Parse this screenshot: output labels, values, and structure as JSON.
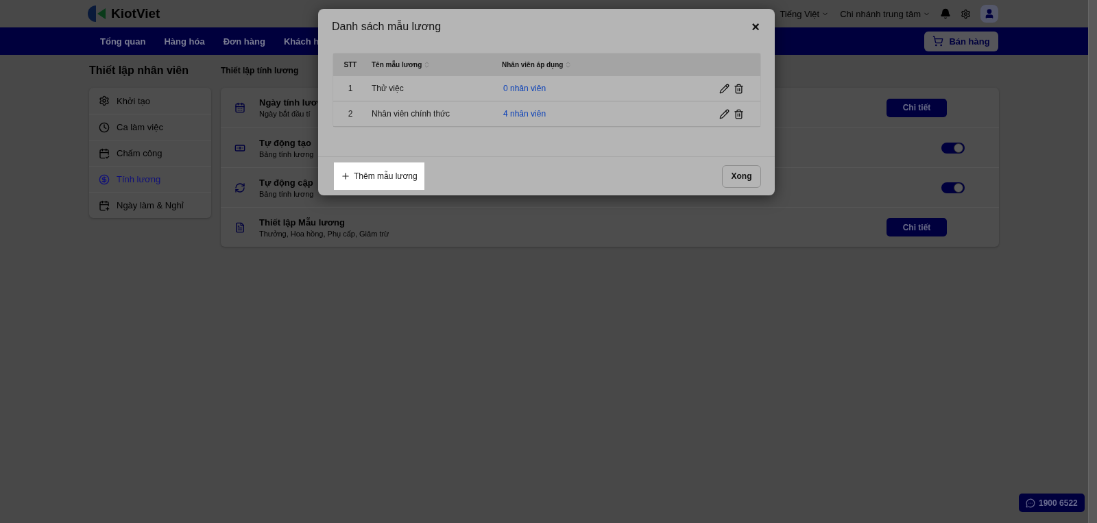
{
  "header": {
    "logo": "KiotViet",
    "language": "Tiếng Việt",
    "branch": "Chi nhánh trung tâm"
  },
  "nav": {
    "items": [
      {
        "label": "Tổng quan"
      },
      {
        "label": "Hàng hóa"
      },
      {
        "label": "Đơn hàng"
      },
      {
        "label": "Khách h"
      }
    ],
    "sell_button": "Bán hàng"
  },
  "sidebar": {
    "title": "Thiết lập nhân viên",
    "items": [
      {
        "label": "Khởi tạo",
        "selected": false
      },
      {
        "label": "Ca làm việc",
        "selected": false
      },
      {
        "label": "Chấm công",
        "selected": false
      },
      {
        "label": "Tính lương",
        "selected": true
      },
      {
        "label": "Ngày làm & Nghỉ",
        "selected": false
      }
    ]
  },
  "main": {
    "title": "Thiết lập tính lương",
    "settings": [
      {
        "kind": "button",
        "title": "Ngày tính lươ",
        "subtitle": "Ngày bắt đầu tí",
        "button": "Chi tiết"
      },
      {
        "kind": "toggle",
        "title": "Tự động tạo",
        "subtitle": "Bảng tính lương",
        "on": true
      },
      {
        "kind": "toggle",
        "title": "Tự động cập",
        "subtitle": "Bảng tính lương",
        "on": true
      },
      {
        "kind": "button",
        "title": "Thiết lập Mẫu lương",
        "subtitle": "Thưởng, Hoa hồng, Phụ cấp, Giảm trừ",
        "button": "Chi tiết"
      }
    ]
  },
  "modal": {
    "title": "Danh sách mẫu lương",
    "close": "×",
    "columns": [
      {
        "label": "STT",
        "sortable": false
      },
      {
        "label": "Tên mẫu lương",
        "sortable": true
      },
      {
        "label": "Nhân viên áp dụng",
        "sortable": true
      }
    ],
    "rows": [
      {
        "stt": "1",
        "name": "Thử việc",
        "employees": "0 nhân viên"
      },
      {
        "stt": "2",
        "name": "Nhân viên chính thức",
        "employees": "4 nhân viên"
      }
    ],
    "add_button": "Thêm mẫu lương",
    "done_button": "Xong"
  },
  "hotline": "1900 6522"
}
